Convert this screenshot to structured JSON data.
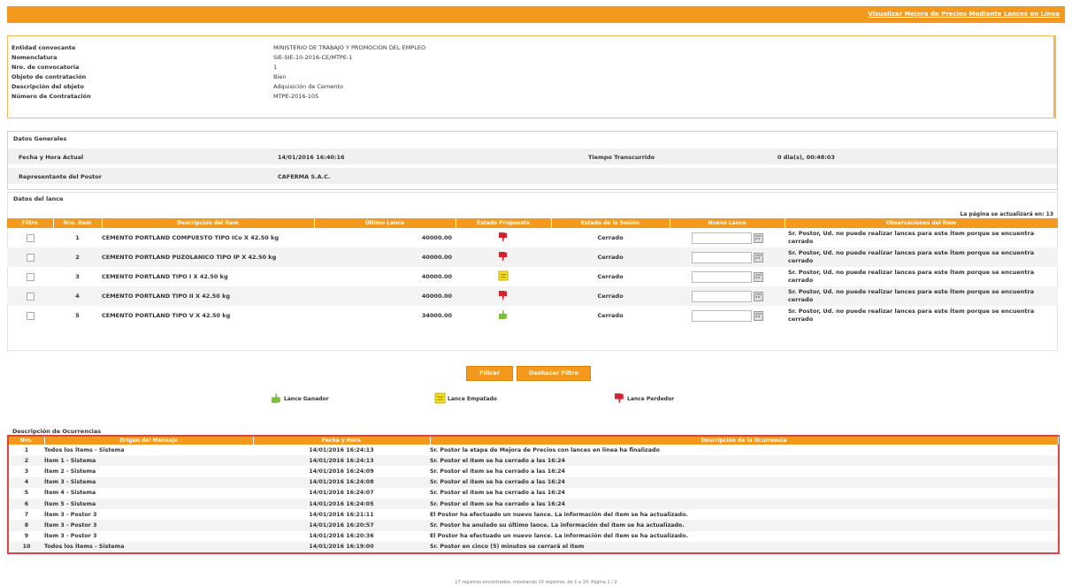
{
  "header": {
    "link_label": "Visualizar Mejora de Precios Mediante Lances en Línea"
  },
  "convocatoria": [
    {
      "label": "Entidad convocante",
      "value": "MINISTERIO DE TRABAJO Y PROMOCION DEL EMPLEO"
    },
    {
      "label": "Nomenclatura",
      "value": "SIE-SIE-10-2016-CE/MTPE-1"
    },
    {
      "label": "Nro. de convocatoria",
      "value": "1"
    },
    {
      "label": "Objeto de contratación",
      "value": "Bien"
    },
    {
      "label": "Descripción del objeto",
      "value": "Adquisición de Cemento"
    },
    {
      "label": "Número de Contratación",
      "value": "MTPE-2016-105"
    }
  ],
  "datos_generales": {
    "title": "Datos Generales",
    "fecha_label": "Fecha y Hora Actual",
    "fecha_value": "14/01/2016 16:40:16",
    "tiempo_label": "Tiempo Transcurrido",
    "tiempo_value": "0 dia(s), 00:48:03",
    "representante_label": "Representante del Postor",
    "representante_value": "CAFERMA S.A.C."
  },
  "datos_lance": {
    "title": "Datos del lance",
    "refresh_note": "La página se actualizará en: 13",
    "headers": [
      "Filtro",
      "Nro. ítem",
      "Descripción del Ítem",
      "Último Lance",
      "Estado Propuesta",
      "Estado de la Sesión",
      "Nuevo Lance",
      "Observaciones del Ítem"
    ],
    "rows": [
      {
        "nro": "1",
        "descripcion": "CEMENTO PORTLAND COMPUESTO TIPO ICo X 42.50 kg",
        "ultimo": "40000.00",
        "estado": "perdedor",
        "sesion": "Cerrado",
        "obs": "Sr. Postor, Ud. no puede realizar lances para este Ítem porque se encuentra cerrado"
      },
      {
        "nro": "2",
        "descripcion": "CEMENTO PORTLAND PUZOLANICO TIPO IP X 42.50 kg",
        "ultimo": "40000.00",
        "estado": "perdedor",
        "sesion": "Cerrado",
        "obs": "Sr. Postor, Ud. no puede realizar lances para este Ítem porque se encuentra cerrado"
      },
      {
        "nro": "3",
        "descripcion": "CEMENTO PORTLAND TIPO I X 42.50 kg",
        "ultimo": "40000.00",
        "estado": "empatado",
        "sesion": "Cerrado",
        "obs": "Sr. Postor, Ud. no puede realizar lances para este Ítem porque se encuentra cerrado"
      },
      {
        "nro": "4",
        "descripcion": "CEMENTO PORTLAND TIPO II X 42.50 kg",
        "ultimo": "40000.00",
        "estado": "perdedor",
        "sesion": "Cerrado",
        "obs": "Sr. Postor, Ud. no puede realizar lances para este Ítem porque se encuentra cerrado"
      },
      {
        "nro": "5",
        "descripcion": "CEMENTO PORTLAND TIPO V X 42.50 kg",
        "ultimo": "34000.00",
        "estado": "ganador",
        "sesion": "Cerrado",
        "obs": "Sr. Postor, Ud. no puede realizar lances para este Ítem porque se encuentra cerrado"
      }
    ]
  },
  "buttons": {
    "filtrar": "Filtrar",
    "deshacer": "Deshacer Filtro"
  },
  "legend": {
    "ganador": "Lance Ganador",
    "empatado": "Lance Empatado",
    "perdedor": "Lance Perdedor"
  },
  "ocurrencias": {
    "title": "Descripción de Ocurrencias",
    "headers": [
      "Nro.",
      "Origen del Mensaje",
      "Fecha y Hora",
      "Descripción de la Ocurrencia"
    ],
    "rows": [
      {
        "nro": "1",
        "origen": "Todos los Ítems - Sistema",
        "fecha": "14/01/2016 16:24:13",
        "desc": "Sr. Postor la etapa de Mejora de Precios con lances en línea ha finalizado"
      },
      {
        "nro": "2",
        "origen": "Ítem 1 - Sistema",
        "fecha": "14/01/2016 16:24:13",
        "desc": "Sr. Postor el ítem se ha cerrado a las 16:24"
      },
      {
        "nro": "3",
        "origen": "Ítem 2 - Sistema",
        "fecha": "14/01/2016 16:24:09",
        "desc": "Sr. Postor el ítem se ha cerrado a las 16:24"
      },
      {
        "nro": "4",
        "origen": "Ítem 3 - Sistema",
        "fecha": "14/01/2016 16:24:08",
        "desc": "Sr. Postor el ítem se ha cerrado a las 16:24"
      },
      {
        "nro": "5",
        "origen": "Ítem 4 - Sistema",
        "fecha": "14/01/2016 16:24:07",
        "desc": "Sr. Postor el ítem se ha cerrado a las 16:24"
      },
      {
        "nro": "6",
        "origen": "Ítem 5 - Sistema",
        "fecha": "14/01/2016 16:24:05",
        "desc": "Sr. Postor el ítem se ha cerrado a las 16:24"
      },
      {
        "nro": "7",
        "origen": "Ítem 3 - Postor 3",
        "fecha": "14/01/2016 16:21:11",
        "desc": "El Postor ha efectuado un nuevo lance. La información del ítem se ha actualizado."
      },
      {
        "nro": "8",
        "origen": "Ítem 3 - Postor 3",
        "fecha": "14/01/2016 16:20:57",
        "desc": "Sr. Postor ha anulado su último lance. La información del ítem se ha actualizado."
      },
      {
        "nro": "9",
        "origen": "Ítem 3 - Postor 3",
        "fecha": "14/01/2016 16:20:36",
        "desc": "El Postor ha efectuado un nuevo lance. La información del ítem se ha actualizado."
      },
      {
        "nro": "10",
        "origen": "Todos los Ítems - Sistema",
        "fecha": "14/01/2016 16:19:00",
        "desc": "Sr. Postor en cinco (5) minutos se cerrará el ítem"
      }
    ]
  },
  "footer_text": "17 registros encontrados, mostrando 10 registros, de 1 a 10. Página 1 / 2",
  "colors": {
    "accent": "#f39a1e",
    "ganador": "#7cbf3b",
    "empatado": "#f4e01e",
    "perdedor": "#d6212f",
    "ocurr_border": "#d9434b"
  }
}
